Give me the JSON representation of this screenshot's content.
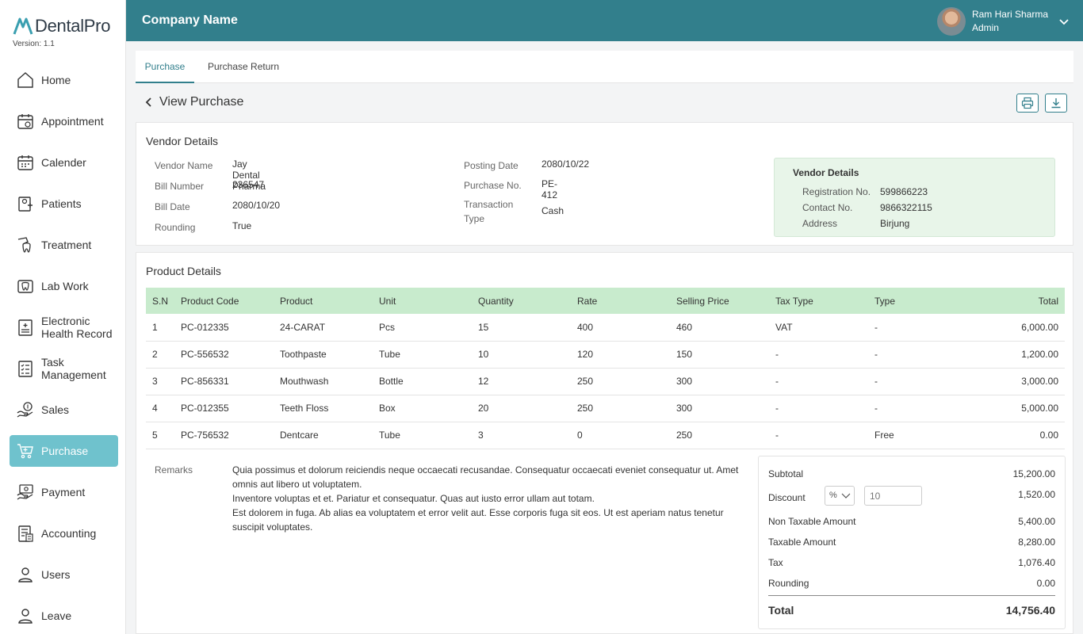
{
  "app": {
    "brand": "DentalPro",
    "version": "Version: 1.1"
  },
  "sidebar": {
    "items": [
      {
        "label": "Home",
        "icon": "home-icon"
      },
      {
        "label": "Appointment",
        "icon": "appointment-icon"
      },
      {
        "label": "Calender",
        "icon": "calendar-icon"
      },
      {
        "label": "Patients",
        "icon": "patients-icon"
      },
      {
        "label": "Treatment",
        "icon": "treatment-icon"
      },
      {
        "label": "Lab Work",
        "icon": "lab-work-icon"
      },
      {
        "label": "Electronic Health Record",
        "icon": "health-record-icon"
      },
      {
        "label": "Task Management",
        "icon": "task-icon"
      },
      {
        "label": "Sales",
        "icon": "sales-icon"
      },
      {
        "label": "Purchase",
        "icon": "purchase-cart-icon",
        "active": true
      },
      {
        "label": "Payment",
        "icon": "payment-icon"
      },
      {
        "label": "Accounting",
        "icon": "accounting-icon"
      },
      {
        "label": "Users",
        "icon": "users-icon"
      },
      {
        "label": "Leave",
        "icon": "leave-icon"
      }
    ]
  },
  "header": {
    "company": "Company Name",
    "user_name": "Ram Hari Sharma",
    "user_role": "Admin"
  },
  "tabs": [
    {
      "label": "Purchase",
      "active": true
    },
    {
      "label": "Purchase Return"
    }
  ],
  "page": {
    "title": "View Purchase"
  },
  "vendor": {
    "section_title": "Vendor Details",
    "left": [
      {
        "label": "Vendor Name",
        "value": "Jay Dental Pharma"
      },
      {
        "label": "Bill Number",
        "value": "236547"
      },
      {
        "label": "Bill Date",
        "value": "2080/10/20"
      },
      {
        "label": "Rounding",
        "value": "True"
      }
    ],
    "middle": [
      {
        "label": "Posting Date",
        "value": "2080/10/22"
      },
      {
        "label": "Purchase No.",
        "value": "PE-412"
      },
      {
        "label": "Transaction Type",
        "value": "Cash"
      }
    ],
    "box": {
      "title": "Vendor Details",
      "rows": [
        {
          "label": "Registration No.",
          "value": "599866223"
        },
        {
          "label": "Contact No.",
          "value": "9866322115"
        },
        {
          "label": "Address",
          "value": "Birjung"
        }
      ]
    }
  },
  "products": {
    "section_title": "Product Details",
    "columns": [
      "S.N",
      "Product Code",
      "Product",
      "Unit",
      "Quantity",
      "Rate",
      "Selling Price",
      "Tax Type",
      "Type",
      "Total"
    ],
    "rows": [
      [
        "1",
        "PC-012335",
        "24-CARAT",
        "Pcs",
        "15",
        "400",
        "460",
        "VAT",
        "-",
        "6,000.00"
      ],
      [
        "2",
        "PC-556532",
        "Toothpaste",
        "Tube",
        "10",
        "120",
        "150",
        "-",
        "-",
        "1,200.00"
      ],
      [
        "3",
        "PC-856331",
        "Mouthwash",
        "Bottle",
        "12",
        "250",
        "300",
        "-",
        "-",
        "3,000.00"
      ],
      [
        "4",
        "PC-012355",
        "Teeth Floss",
        "Box",
        "20",
        "250",
        "300",
        "-",
        "-",
        "5,000.00"
      ],
      [
        "5",
        "PC-756532",
        "Dentcare",
        "Tube",
        "3",
        "0",
        "250",
        "-",
        "Free",
        "0.00"
      ]
    ]
  },
  "remarks": {
    "label": "Remarks",
    "text": "Quia possimus et dolorum reiciendis neque occaecati recusandae. Consequatur occaecati eveniet consequatur ut. Amet omnis aut libero ut voluptatem.\n  Inventore voluptas et et. Pariatur et consequatur. Quas aut iusto error ullam aut totam.\n  Est dolorem in fuga. Ab alias ea voluptatem et error velit aut. Esse corporis fuga sit eos. Ut est aperiam natus tenetur suscipit voluptates."
  },
  "summary": {
    "subtotal_label": "Subtotal",
    "subtotal": "15,200.00",
    "discount_label": "Discount",
    "discount_type": "%",
    "discount_input": "10",
    "discount": "1,520.00",
    "non_taxable_label": "Non Taxable Amount",
    "non_taxable": "5,400.00",
    "taxable_label": "Taxable Amount",
    "taxable": "8,280.00",
    "tax_label": "Tax",
    "tax": "1,076.40",
    "rounding_label": "Rounding",
    "rounding": "0.00",
    "total_label": "Total",
    "total": "14,756.40"
  },
  "colors": {
    "primary": "#327f8c",
    "active_nav": "#6fc2cd",
    "table_header": "#c8ebcd",
    "vendor_box": "#e8f5e9"
  }
}
